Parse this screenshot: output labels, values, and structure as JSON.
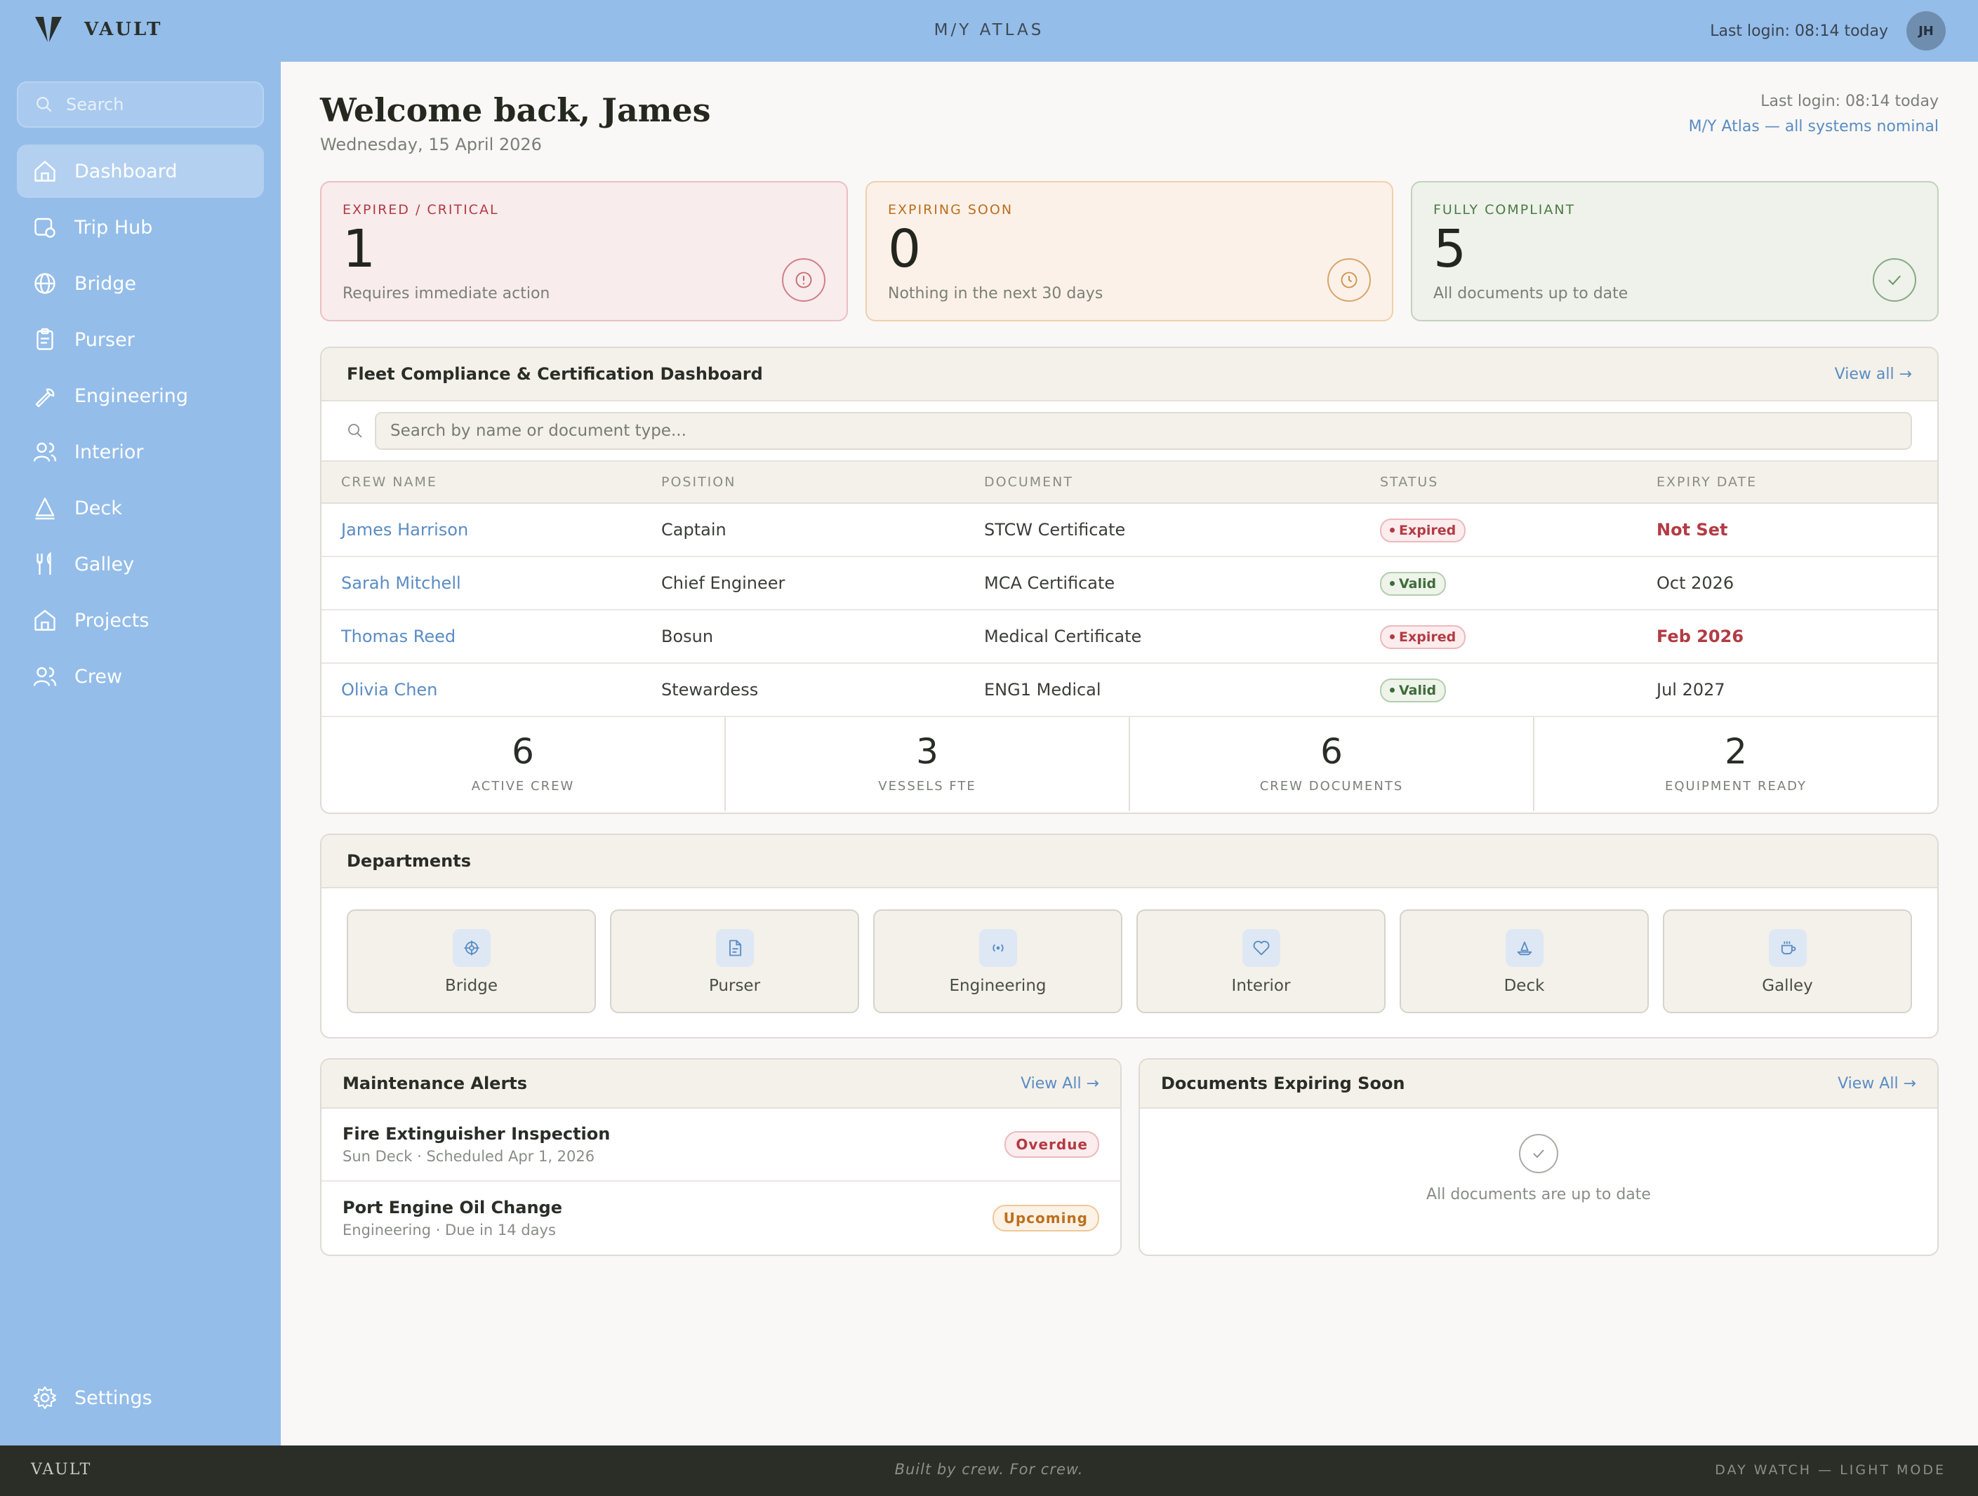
{
  "brand": {
    "name": "VAULT"
  },
  "topbar": {
    "vessel": "M/Y ATLAS",
    "last_login": "Last login: 08:14 today",
    "avatar": "JH"
  },
  "sidebar": {
    "search_placeholder": "Search",
    "items": [
      {
        "label": "Dashboard",
        "icon": "home-icon",
        "active": true
      },
      {
        "label": "Trip Hub",
        "icon": "trip-hub-icon"
      },
      {
        "label": "Bridge",
        "icon": "globe-icon"
      },
      {
        "label": "Purser",
        "icon": "clipboard-icon"
      },
      {
        "label": "Engineering",
        "icon": "wrench-icon"
      },
      {
        "label": "Interior",
        "icon": "users-icon"
      },
      {
        "label": "Deck",
        "icon": "sail-icon"
      },
      {
        "label": "Galley",
        "icon": "utensils-icon"
      },
      {
        "label": "Projects",
        "icon": "building-icon"
      },
      {
        "label": "Crew",
        "icon": "crew-icon"
      }
    ],
    "settings": "Settings"
  },
  "header": {
    "welcome": "Welcome back, James",
    "date": "Wednesday, 15 April 2026",
    "last_login": "Last login: 08:14 today",
    "status": "M/Y Atlas — all systems nominal"
  },
  "stats": {
    "critical": {
      "label": "EXPIRED / CRITICAL",
      "value": "1",
      "sub": "Requires immediate action"
    },
    "soon": {
      "label": "EXPIRING SOON",
      "value": "0",
      "sub": "Nothing in the next 30 days"
    },
    "ok": {
      "label": "FULLY COMPLIANT",
      "value": "5",
      "sub": "All documents up to date"
    }
  },
  "compliance": {
    "title": "Fleet Compliance & Certification Dashboard",
    "view_all": "View all →",
    "search_placeholder": "Search by name or document type...",
    "columns": [
      "CREW NAME",
      "POSITION",
      "DOCUMENT",
      "STATUS",
      "EXPIRY DATE"
    ],
    "rows": [
      {
        "name": "James Harrison",
        "position": "Captain",
        "document": "STCW Certificate",
        "status": "Expired",
        "expiry": "Not Set"
      },
      {
        "name": "Sarah Mitchell",
        "position": "Chief Engineer",
        "document": "MCA Certificate",
        "status": "Valid",
        "expiry": "Oct 2026"
      },
      {
        "name": "Thomas Reed",
        "position": "Bosun",
        "document": "Medical Certificate",
        "status": "Expired",
        "expiry": "Feb 2026"
      },
      {
        "name": "Olivia Chen",
        "position": "Stewardess",
        "document": "ENG1 Medical",
        "status": "Valid",
        "expiry": "Jul 2027"
      }
    ],
    "metrics": [
      {
        "value": "6",
        "label": "ACTIVE CREW"
      },
      {
        "value": "3",
        "label": "VESSELS FTE"
      },
      {
        "value": "6",
        "label": "CREW DOCUMENTS"
      },
      {
        "value": "2",
        "label": "EQUIPMENT READY"
      }
    ]
  },
  "departments": {
    "title": "Departments",
    "items": [
      "Bridge",
      "Purser",
      "Engineering",
      "Interior",
      "Deck",
      "Galley"
    ]
  },
  "maintenance": {
    "title": "Maintenance Alerts",
    "view_all": "View All →",
    "items": [
      {
        "title": "Fire Extinguisher Inspection",
        "sub": "Sun Deck · Scheduled Apr 1, 2026",
        "badge": "Overdue"
      },
      {
        "title": "Port Engine Oil Change",
        "sub": "Engineering · Due in 14 days",
        "badge": "Upcoming"
      }
    ]
  },
  "documents": {
    "title": "Documents Expiring Soon",
    "view_all": "View All →",
    "empty": "All documents are up to date"
  },
  "footer": {
    "brand": "VAULT",
    "tagline": "Built by crew. For crew.",
    "mode": "DAY WATCH — LIGHT MODE"
  },
  "colors": {
    "sidebar": "#94bde9",
    "accent": "#5a8cc4",
    "danger": "#b23b44",
    "warning": "#bd6f1d",
    "success": "#4d7a46",
    "footer": "#2a2e27"
  }
}
